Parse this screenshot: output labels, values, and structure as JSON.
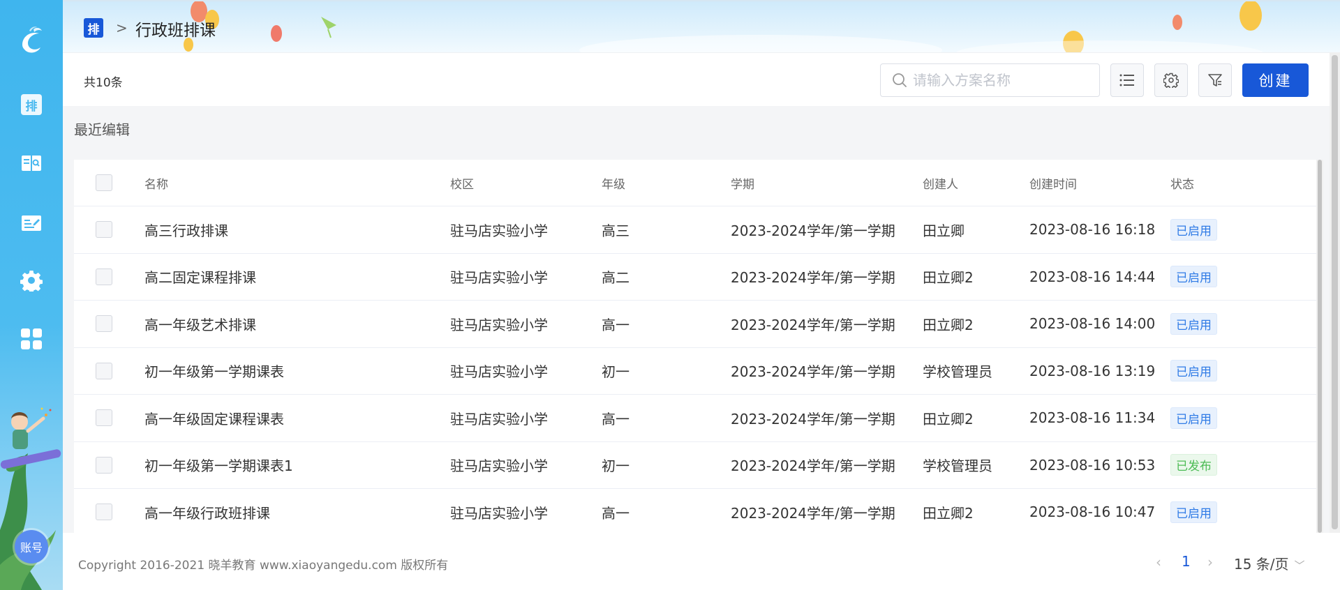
{
  "breadcrumb": {
    "badge": "排",
    "separator": ">",
    "title": "行政班排课"
  },
  "sidebar": {
    "active_badge": "排",
    "items": [
      {
        "name": "schedule",
        "icon": "schedule-icon"
      },
      {
        "name": "course-book",
        "icon": "book-search-icon"
      },
      {
        "name": "edit",
        "icon": "edit-doc-icon"
      },
      {
        "name": "settings",
        "icon": "gear-icon"
      },
      {
        "name": "apps",
        "icon": "grid-apps-icon"
      }
    ],
    "account_label": "账号"
  },
  "toolbar": {
    "total": "共10条",
    "search_placeholder": "请输入方案名称",
    "create_label": "创建"
  },
  "section_title": "最近编辑",
  "table": {
    "columns": [
      "名称",
      "校区",
      "年级",
      "学期",
      "创建人",
      "创建时间",
      "状态"
    ],
    "rows": [
      {
        "name": "高三行政排课",
        "campus": "驻马店实验小学",
        "grade": "高三",
        "term": "2023-2024学年/第一学期",
        "creator": "田立卿",
        "created": "2023-08-16 16:18",
        "status": "已启用",
        "status_type": "blue"
      },
      {
        "name": "高二固定课程排课",
        "campus": "驻马店实验小学",
        "grade": "高二",
        "term": "2023-2024学年/第一学期",
        "creator": "田立卿2",
        "created": "2023-08-16 14:44",
        "status": "已启用",
        "status_type": "blue"
      },
      {
        "name": "高一年级艺术排课",
        "campus": "驻马店实验小学",
        "grade": "高一",
        "term": "2023-2024学年/第一学期",
        "creator": "田立卿2",
        "created": "2023-08-16 14:00",
        "status": "已启用",
        "status_type": "blue"
      },
      {
        "name": "初一年级第一学期课表",
        "campus": "驻马店实验小学",
        "grade": "初一",
        "term": "2023-2024学年/第一学期",
        "creator": "学校管理员",
        "created": "2023-08-16 13:19",
        "status": "已启用",
        "status_type": "blue"
      },
      {
        "name": "高一年级固定课程课表",
        "campus": "驻马店实验小学",
        "grade": "高一",
        "term": "2023-2024学年/第一学期",
        "creator": "田立卿2",
        "created": "2023-08-16 11:34",
        "status": "已启用",
        "status_type": "blue"
      },
      {
        "name": "初一年级第一学期课表1",
        "campus": "驻马店实验小学",
        "grade": "初一",
        "term": "2023-2024学年/第一学期",
        "creator": "学校管理员",
        "created": "2023-08-16 10:53",
        "status": "已发布",
        "status_type": "green"
      },
      {
        "name": "高一年级行政班排课",
        "campus": "驻马店实验小学",
        "grade": "高一",
        "term": "2023-2024学年/第一学期",
        "creator": "田立卿2",
        "created": "2023-08-16 10:47",
        "status": "已启用",
        "status_type": "blue"
      }
    ]
  },
  "footer": {
    "copyright": "Copyright 2016-2021 晓羊教育 www.xiaoyangedu.com 版权所有",
    "pagination": {
      "prev": "‹",
      "current": "1",
      "next": "›",
      "page_size": "15 条/页"
    }
  },
  "colors": {
    "primary": "#1858d8",
    "sidebar": "#48b8ef",
    "status_enabled": "#2f7be6",
    "status_published": "#4cbc55"
  }
}
